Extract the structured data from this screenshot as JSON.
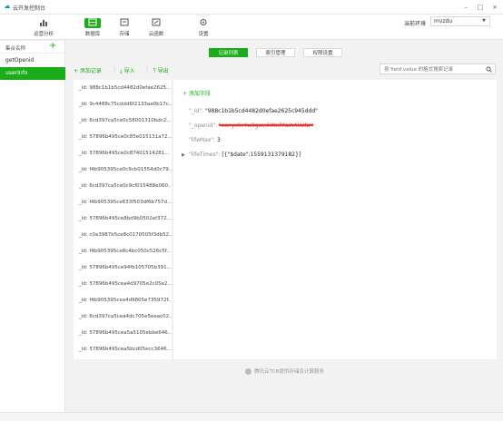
{
  "window": {
    "title": "云开发控制台",
    "minimize": "–",
    "maximize": "□",
    "close": "×"
  },
  "toolbar": {
    "tools": [
      "运营分析",
      "数据库",
      "存储",
      "云函数",
      "设置"
    ],
    "env_label": "当前环境",
    "env_value": "mvzdu"
  },
  "sidebar": {
    "header": "集合名称",
    "add": "+",
    "collections": [
      "getOpenid",
      "userInfo"
    ],
    "active": "userInfo"
  },
  "tabs": [
    "记录列表",
    "索引管理",
    "权限设置"
  ],
  "actions": {
    "add_record": "+ 添加记录",
    "import": "导入",
    "export": "导出"
  },
  "search": {
    "placeholder": "按 field value 的格式搜索记录"
  },
  "documents": [
    "_id: 988c1b1b5cd4482d0efae2625...",
    "_id: 9c4488c75cddd6f2133aa0b17c...",
    "_id: 6cd397ca5ce0c58001310bdc2...",
    "_id: 57896b495ce0c85e015131a72...",
    "_id: 57896b495ce0c87401514281...",
    "_id: f4b905395ce0c9cb01554d0c79...",
    "_id: 6cd397ca5ce0c9cf015488e060...",
    "_id: f4b905395ce633f503df6b757d...",
    "_id: 57896b495ce8bd9b0502ef372...",
    "_id: c0a3987b5ce8c0170505f3db52...",
    "_id: f4b905395ce8c4bc050c526c5f...",
    "_id: 57896b495ce94fb105705b391...",
    "_id: 57896b495cea4d9705e2c05e2...",
    "_id: f4b905395cea4d9805e735972f...",
    "_id: 6cd397ca5cea4dc705e5eeac02...",
    "_id: 57896b495cea5a5105ebbe646...",
    "_id: 57896b495cea5bcd05ecc3646..."
  ],
  "detail": {
    "add_field": "+ 添加字段",
    "fields": [
      {
        "key": "\"_id\":",
        "value": "\"988c1b1b5cd4482d0efae2625c945ddd\"",
        "redacted": false
      },
      {
        "key": "\"_openid\":",
        "value": "\"oenyxhr4w8gsm90tnPAUAAkUNr\"",
        "redacted": true
      },
      {
        "key": "\"lifeMax\":",
        "value": "3",
        "redacted": false
      },
      {
        "key": "\"lifeTimes\":",
        "value": "[{\"$date\":1559131379182}]",
        "redacted": false
      }
    ],
    "expand_glyph": "▶"
  },
  "footer": "腾讯云TCB提供存储及计算服务",
  "colors": {
    "accent": "#1aad19",
    "redaction": "#e33333"
  }
}
